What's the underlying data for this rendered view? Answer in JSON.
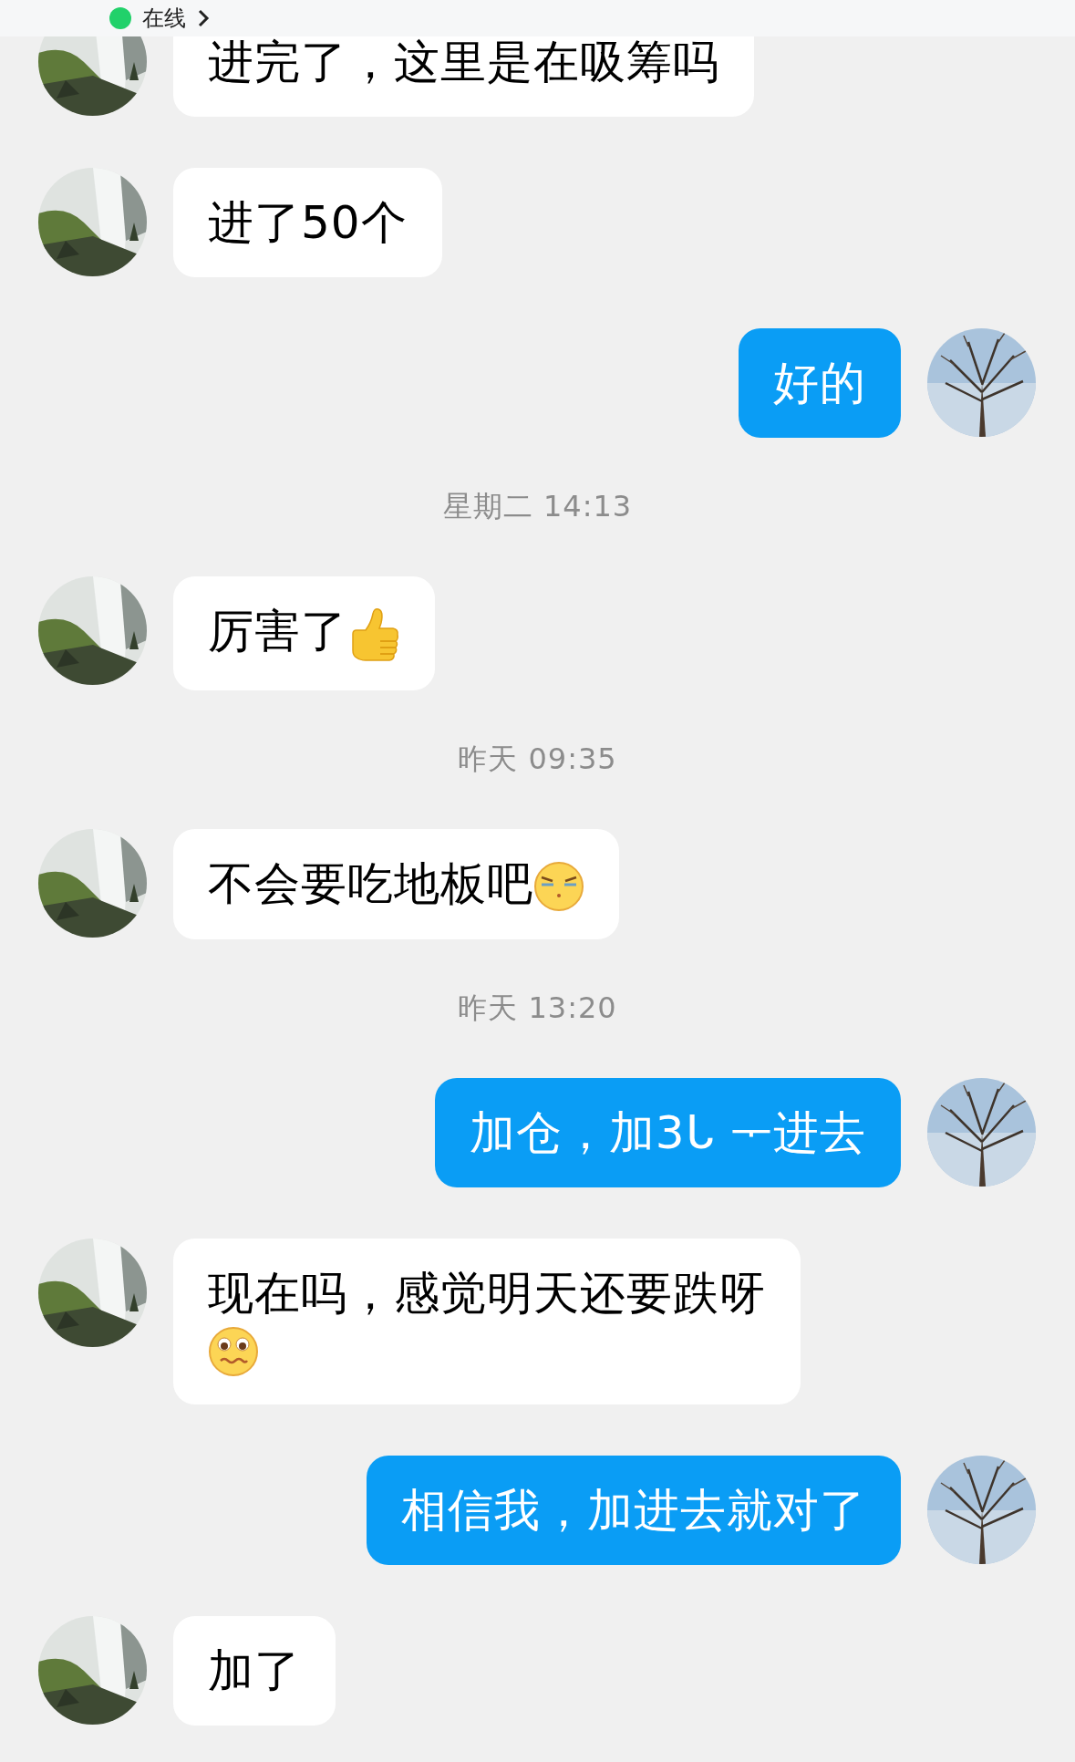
{
  "header": {
    "status": "在线"
  },
  "messages": [
    {
      "kind": "incoming",
      "text": "进完了，这里是在吸筹吗"
    },
    {
      "kind": "incoming",
      "text": "进了50个"
    },
    {
      "kind": "outgoing",
      "text": "好的"
    },
    {
      "kind": "time",
      "text": "星期二 14:13"
    },
    {
      "kind": "incoming",
      "text": "厉害了",
      "emoji": {
        "kind": "thumbs_up"
      }
    },
    {
      "kind": "time",
      "text": "昨天 09:35"
    },
    {
      "kind": "incoming",
      "text": "不会要吃地板吧",
      "emoji": {
        "kind": "squint"
      }
    },
    {
      "kind": "time",
      "text": "昨天 13:20"
    },
    {
      "kind": "outgoing",
      "text": "加仓，加3ᒐ ᅮ进去"
    },
    {
      "kind": "incoming",
      "text": "现在吗，感觉明天还要跌呀",
      "emoji": {
        "kind": "worried"
      }
    },
    {
      "kind": "outgoing",
      "text": "相信我，加进去就对了"
    },
    {
      "kind": "incoming",
      "text": "加了"
    }
  ]
}
